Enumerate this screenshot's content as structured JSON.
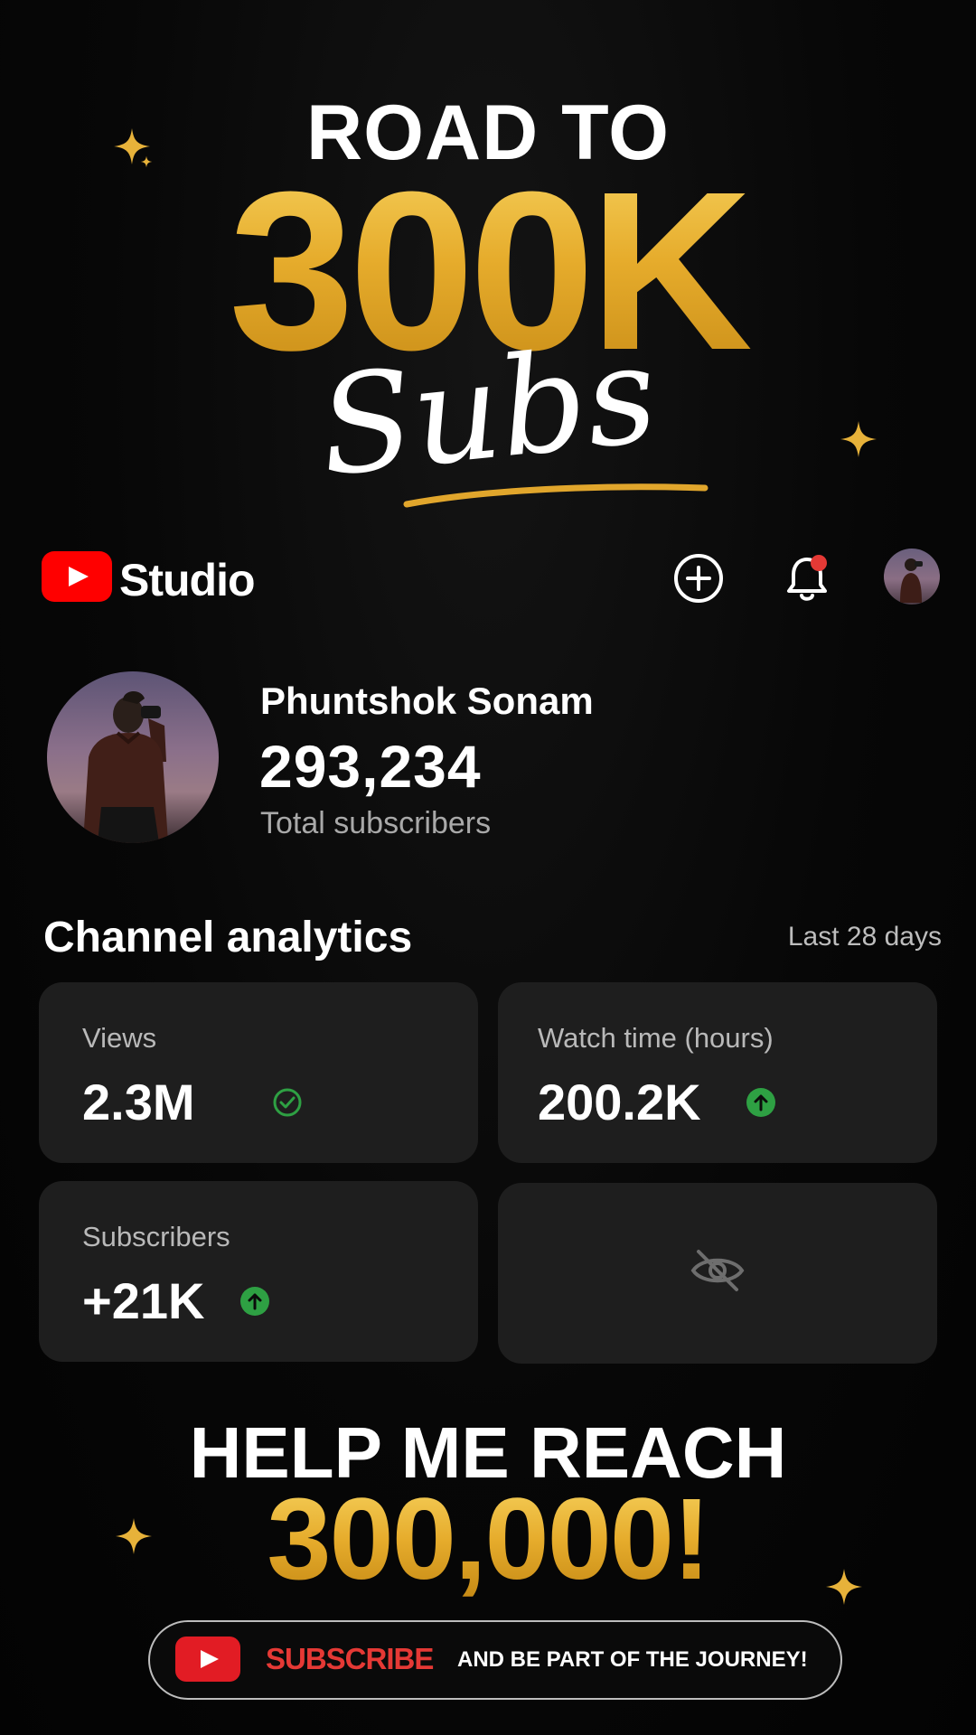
{
  "banner": {
    "road_to": "ROAD TO",
    "goal": "300K",
    "subs": "Subs"
  },
  "header": {
    "studio_label": "Studio",
    "icons": [
      "add-circle-icon",
      "bell-icon",
      "avatar"
    ],
    "notification_dot_color": "#e53935"
  },
  "channel": {
    "name": "Phuntshok Sonam",
    "subscriber_count": "293,234",
    "subscriber_label": "Total subscribers"
  },
  "analytics": {
    "title": "Channel analytics",
    "period": "Last 28 days",
    "cards": [
      {
        "label": "Views",
        "value": "2.3M",
        "badge": "check-circle-icon"
      },
      {
        "label": "Watch time (hours)",
        "value": "200.2K",
        "badge": "arrow-up-icon"
      },
      {
        "label": "Subscribers",
        "value": "+21K",
        "badge": "arrow-up-icon"
      },
      {
        "label": "",
        "value": "",
        "badge": "eye-off-icon"
      }
    ]
  },
  "footer": {
    "help_title": "HELP ME REACH",
    "help_number": "300,000!",
    "cta_subscribe": "SUBSCRIBE",
    "cta_rest": "AND BE PART OF THE JOURNEY!"
  },
  "colors": {
    "gold": "#e6ac2c",
    "youtube_red": "#ff0000",
    "positive_green": "#2ea043",
    "card_bg": "#1e1e1e"
  }
}
